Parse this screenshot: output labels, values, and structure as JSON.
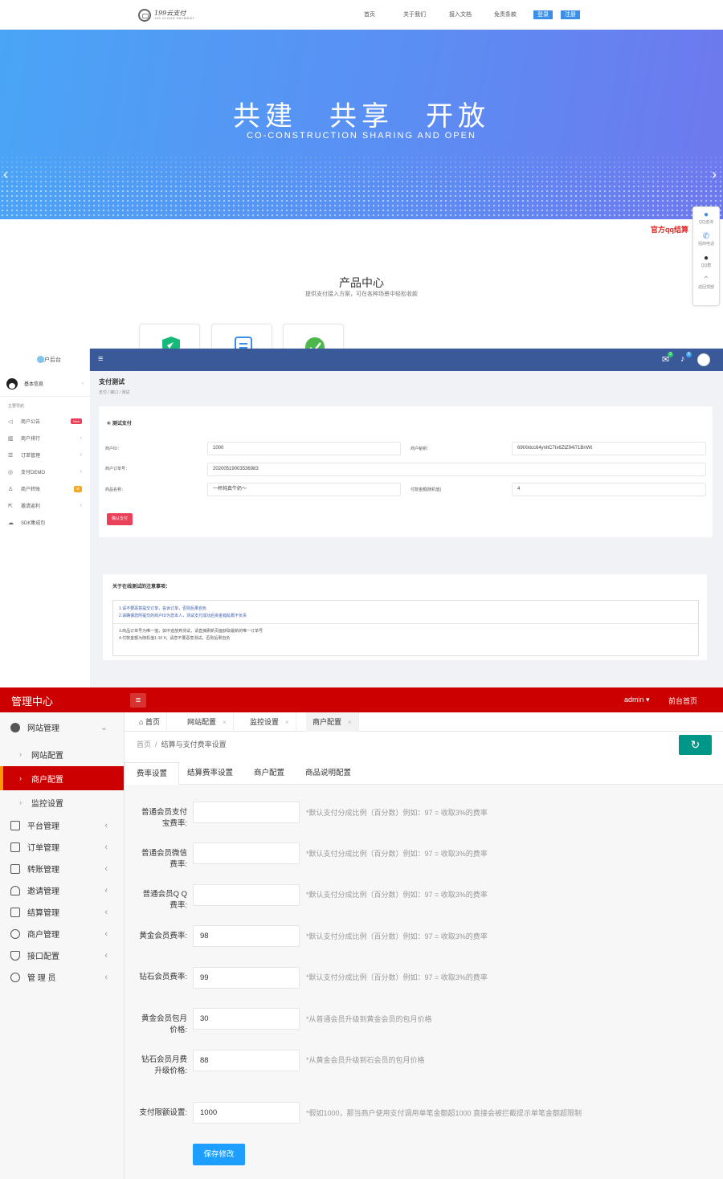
{
  "site": {
    "logo_line1": "199云支付",
    "logo_line2": "199 CLOUD PAYMENT",
    "nav": [
      "首页",
      "关于我们",
      "接入文档",
      "免责条款"
    ],
    "login": "登录",
    "register": "注册",
    "banner_title": "共建　共享　开放",
    "banner_subtitle": "CO-CONSTRUCTION  SHARING  AND  OPEN",
    "product_title": "产品中心",
    "product_subtitle": "提供支付接入方案，可在各种场景中轻松收款",
    "qq_tip": "官方qq结算",
    "float_items": [
      "QQ咨询",
      "招商电话",
      "QQ群",
      "返回顶部"
    ],
    "colors": {
      "banner_start": "#4aa5f6",
      "banner_end": "#6e78ee",
      "button": "#3b8fe8",
      "tip": "#e0241f"
    }
  },
  "merchant": {
    "brand": "商户后台",
    "user": "基本信息",
    "nav_label": "主要导航",
    "menu": [
      {
        "label": "商户公告",
        "icon": "speaker-icon",
        "tag": "New",
        "tag_color": "#e9415a"
      },
      {
        "label": "商户排行",
        "icon": "bar-chart-icon",
        "chev": "‹"
      },
      {
        "label": "订单管理",
        "icon": "list-icon",
        "chev": "‹"
      },
      {
        "label": "支付DEMO",
        "icon": "coin-icon",
        "chev": "‹"
      },
      {
        "label": "商户转账",
        "icon": "user-transfer-icon",
        "tag": "转",
        "tag_color": "#f5a623"
      },
      {
        "label": "邀请返利",
        "icon": "share-icon",
        "chev": "‹"
      },
      {
        "label": "SDK集成包",
        "icon": "cloud-icon"
      }
    ],
    "badges": {
      "mail": "3",
      "bell": "8"
    },
    "page_title": "支付测试",
    "breadcrumb": "支付 / 接口 / 测试",
    "card_title": "⑥ 测试支付",
    "fields": {
      "merchant_id_label": "商户ID：",
      "merchant_id": "1000",
      "merchant_key_label": "商户秘钥：",
      "merchant_key": "69tXktcc64ynltC7Ix6ZtZ94i71BnWt",
      "order_no_label": "商户订单号：",
      "order_no": "20200519003536983",
      "product_label": "商品名称：",
      "product_name": "一杯纯真牛奶～",
      "amount_label": "付款金额[随机值]",
      "amount": "4"
    },
    "pay_button": "确认支付",
    "notes_title": "关于在线测试的注意事项：",
    "notes": [
      "1.请不要恶意提交订单，投诉订单，否则后果自负",
      "2.请确保您所提交的商户ID为您本人，测试支付成功后资金错乱概不负责",
      "3.商品订单号为唯一值，如中途放弃测试，请直接刷新页面获取最新的唯一订单号",
      "4.付款金额为随机值1-10 ¥；请您不要恶意测试，否则后果自负"
    ],
    "colors": {
      "header": "#3a5998",
      "pay": "#e9415a"
    }
  },
  "admin": {
    "logo": "管理中心",
    "user": "admin",
    "front": "前台首页",
    "sidebar": {
      "group": "网站管理",
      "subs": [
        "网站配置",
        "商户配置",
        "监控设置"
      ],
      "items": [
        "平台管理",
        "订单管理",
        "转账管理",
        "邀请管理",
        "结算管理",
        "商户管理",
        "接口配置",
        "管 理 员"
      ]
    },
    "tabs": [
      {
        "label": "首页",
        "icon": "home-icon"
      },
      {
        "label": "网站配置",
        "close": "×"
      },
      {
        "label": "监控设置",
        "close": "×"
      },
      {
        "label": "商户配置",
        "close": "×"
      }
    ],
    "breadcrumb": {
      "home": "首页",
      "sep": "/",
      "current": "结算与支付费率设置"
    },
    "subtabs": [
      "费率设置",
      "结算费率设置",
      "商户配置",
      "商品说明配置"
    ],
    "form": [
      {
        "label": "普通会员支付宝费率:",
        "value": "",
        "hint": "*默认支付分成比例（百分数）例如：97 = 收取3%的费率"
      },
      {
        "label": "普通会员微信费率:",
        "value": "",
        "hint": "*默认支付分成比例（百分数）例如：97 = 收取3%的费率"
      },
      {
        "label": "普通会员Q Q费率:",
        "value": "",
        "hint": "*默认支付分成比例（百分数）例如：97 = 收取3%的费率"
      },
      {
        "label": "黄金会员费率:",
        "value": "98",
        "hint": "*默认支付分成比例（百分数）例如：97 = 收取3%的费率"
      },
      {
        "label": "钻石会员费率:",
        "value": "99",
        "hint": "*默认支付分成比例（百分数）例如：97 = 收取3%的费率"
      },
      {
        "label": "黄金会员包月价格:",
        "value": "30",
        "hint": "*从普通会员升级到黄金会员的包月价格"
      },
      {
        "label": "钻石会员月费升级价格:",
        "value": "88",
        "hint": "*从黄金会员升级到石会员的包月价格"
      },
      {
        "label": "支付限额设置:",
        "value": "1000",
        "hint": "*假如1000，那当商户使用支付调用单笔金额超1000 直接会被拦截提示单笔金额超限制"
      }
    ],
    "save": "保存修改",
    "colors": {
      "header": "#cc0000",
      "active_marker": "#ff9900",
      "refresh": "#009688",
      "save": "#1e9fff"
    }
  }
}
